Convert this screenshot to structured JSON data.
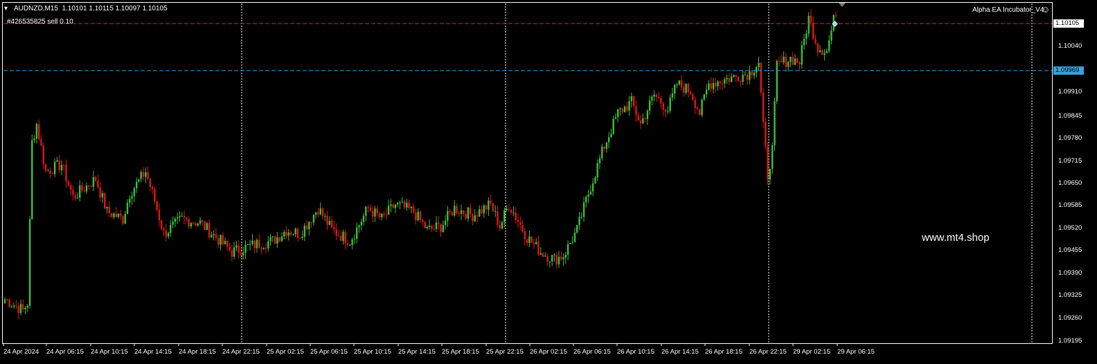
{
  "header": {
    "symbol_info": "AUDNZD,M15  1.10101 1.10115 1.10097 1.10105",
    "order_label": "#426535825 sell 0.10",
    "ea_name": "Alpha EA Incubator_V4",
    "ea_icon": "smiley-icon",
    "menu_icon": "triangle-down-icon"
  },
  "watermark": "www.mt4.shop",
  "colors": {
    "background": "#000000",
    "bull": "#3fbf3f",
    "bear": "#e01818",
    "order_line": "#c0392b",
    "bid_line": "#3aa0d8",
    "bid_tag_bg": "#3aa0d8",
    "ask_tag_bg": "#ffffff",
    "grid": "#ffffff"
  },
  "price_axis": {
    "ticks": [
      "1.10040",
      "1.09910",
      "1.09845",
      "1.09780",
      "1.09715",
      "1.09650",
      "1.09585",
      "1.09520",
      "1.09455",
      "1.09390",
      "1.09325",
      "1.09260",
      "1.09195"
    ],
    "current_price": "1.10105",
    "bid_price": "1.09969"
  },
  "time_axis": {
    "ticks": [
      "24 Apr 2024",
      "24 Apr 06:15",
      "24 Apr 10:15",
      "24 Apr 14:15",
      "24 Apr 18:15",
      "24 Apr 22:15",
      "25 Apr 02:15",
      "25 Apr 06:15",
      "25 Apr 10:15",
      "25 Apr 14:15",
      "25 Apr 18:15",
      "25 Apr 22:15",
      "26 Apr 02:15",
      "26 Apr 06:15",
      "26 Apr 10:15",
      "26 Apr 14:15",
      "26 Apr 18:15",
      "26 Apr 22:15",
      "29 Apr 02:15",
      "29 Apr 06:15"
    ]
  },
  "chart_data": {
    "type": "candlestick",
    "symbol": "AUDNZD",
    "timeframe": "M15",
    "ylim": [
      1.0919,
      1.1012
    ],
    "anchors": [
      [
        0,
        1.0931
      ],
      [
        8,
        1.0928
      ],
      [
        10,
        1.093
      ],
      [
        12,
        1.0974
      ],
      [
        14,
        1.0979
      ],
      [
        18,
        1.0966
      ],
      [
        25,
        1.0968
      ],
      [
        30,
        1.0959
      ],
      [
        40,
        1.0964
      ],
      [
        45,
        1.0955
      ],
      [
        52,
        1.0953
      ],
      [
        55,
        1.096
      ],
      [
        62,
        1.0966
      ],
      [
        66,
        1.0958
      ],
      [
        70,
        1.0949
      ],
      [
        78,
        1.0953
      ],
      [
        86,
        1.0952
      ],
      [
        100,
        1.0944
      ],
      [
        110,
        1.0946
      ],
      [
        118,
        1.0947
      ],
      [
        124,
        1.095
      ],
      [
        130,
        1.0949
      ],
      [
        138,
        1.0956
      ],
      [
        144,
        1.095
      ],
      [
        152,
        1.0947
      ],
      [
        160,
        1.0956
      ],
      [
        166,
        1.0953
      ],
      [
        172,
        1.0957
      ],
      [
        180,
        1.0955
      ],
      [
        186,
        1.095
      ],
      [
        192,
        1.0951
      ],
      [
        198,
        1.0956
      ],
      [
        206,
        1.0954
      ],
      [
        214,
        1.0957
      ],
      [
        218,
        1.0951
      ],
      [
        222,
        1.0957
      ],
      [
        230,
        1.0948
      ],
      [
        236,
        1.0944
      ],
      [
        242,
        1.0942
      ],
      [
        246,
        1.0943
      ],
      [
        252,
        1.095
      ],
      [
        258,
        1.0962
      ],
      [
        264,
        1.0973
      ],
      [
        270,
        1.0982
      ],
      [
        276,
        1.0985
      ],
      [
        280,
        1.0979
      ],
      [
        286,
        1.0987
      ],
      [
        292,
        1.0983
      ],
      [
        296,
        1.099
      ],
      [
        302,
        1.0988
      ],
      [
        306,
        1.0982
      ],
      [
        310,
        1.099
      ],
      [
        316,
        1.0991
      ],
      [
        322,
        1.0992
      ],
      [
        328,
        1.0993
      ],
      [
        332,
        1.0996
      ],
      [
        334,
        1.0978
      ],
      [
        336,
        1.0965
      ],
      [
        338,
        1.0972
      ],
      [
        340,
        1.0995
      ],
      [
        346,
        1.0997
      ],
      [
        350,
        1.0996
      ],
      [
        354,
        1.1008
      ],
      [
        358,
        1.1
      ],
      [
        362,
        1.0999
      ],
      [
        366,
        1.101
      ]
    ]
  }
}
